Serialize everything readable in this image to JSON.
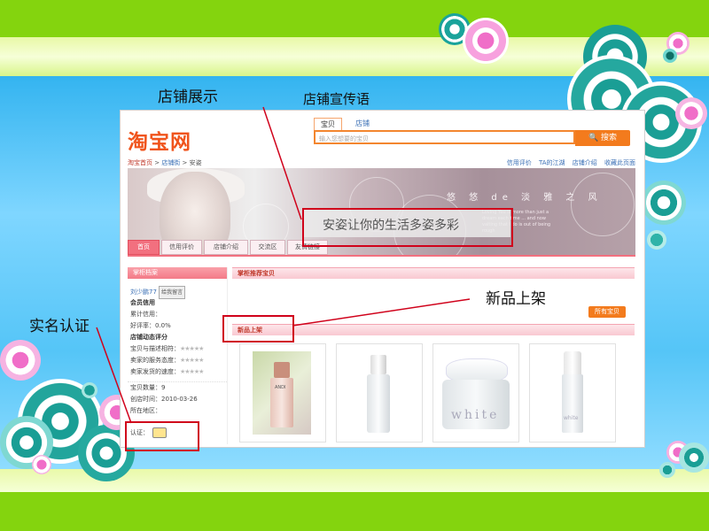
{
  "taobao": {
    "logo": "淘宝网",
    "search": {
      "tabs": [
        "宝贝",
        "店铺"
      ],
      "placeholder": "输入您想要的宝贝",
      "button": "🔍 搜索"
    },
    "breadcrumb": {
      "home": "淘宝首页",
      "sep1": " > ",
      "street": "店铺街",
      "sep2": " > ",
      "shop": "安姿"
    },
    "top_links": [
      "信用评价",
      "TA的江湖",
      "店铺介绍",
      "收藏此页面"
    ],
    "banner": {
      "tagline": "悠 悠 de 淡 雅 之 风",
      "small_text": "Loving You is more than just a dream each time ... and now vaiting that I do is out of being rough",
      "slogan": "安姿让你的生活多姿多彩"
    },
    "nav_tabs": [
      "首页",
      "信用评价",
      "店铺介绍",
      "交流区",
      "友情链接"
    ],
    "sidebar": {
      "header": "掌柜档案",
      "seller_name": "刘少鹏77",
      "message_button": "给我留言",
      "credit_title": "会员信用",
      "credit_label": "累计信用：",
      "positive_rate": "好评率：0.0%",
      "dynamic_title": "店铺动态评分",
      "ratings": [
        {
          "label": "宝贝与描述相符：",
          "stars": "★★★★★"
        },
        {
          "label": "卖家的服务态度：",
          "stars": "★★★★★"
        },
        {
          "label": "卖家发货的速度：",
          "stars": "★★★★★"
        }
      ],
      "item_count": "宝贝数量：9",
      "created": "创店时间：2010-03-26",
      "location": "所在地区：",
      "certification": "认证："
    },
    "main": {
      "recommended_header": "掌柜推荐宝贝",
      "all_items_button": "所有宝贝",
      "new_arrivals_header": "新品上架",
      "products": [
        {
          "name": "ANDI lotion bottle",
          "brand": "ANDI"
        },
        {
          "name": "clear toner bottle",
          "brand": ""
        },
        {
          "name": "white cream jar",
          "brand": "white"
        },
        {
          "name": "white essence bottle",
          "brand": "white"
        }
      ]
    }
  },
  "callouts": {
    "shop_display": "店铺展示",
    "shop_slogan": "店铺宣传语",
    "new_arrivals": "新品上架",
    "real_name_cert": "实名认证"
  },
  "colors": {
    "annotation_red": "#d0021b",
    "taobao_orange": "#f37b1d",
    "nav_pink": "#f2707f",
    "lime_green": "#84d40e",
    "sky_blue": "#55c5f7"
  }
}
